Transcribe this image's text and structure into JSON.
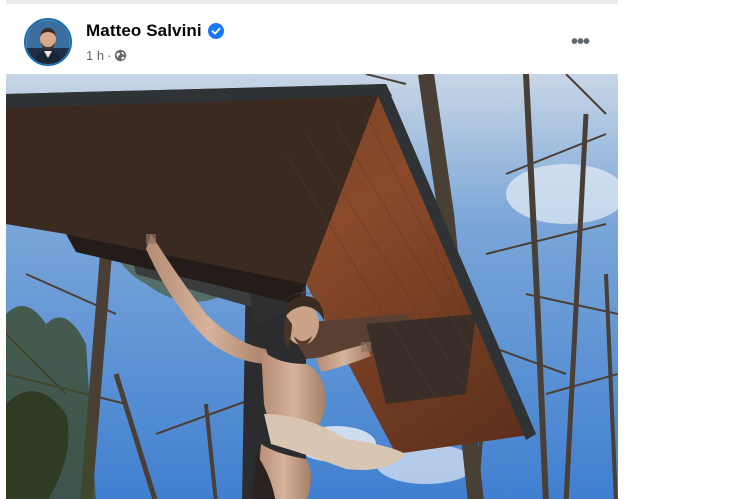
{
  "post": {
    "author_name": "Matteo Salvini",
    "verified": true,
    "timestamp": "1 h",
    "separator": "·",
    "privacy_icon": "globe-icon",
    "more_icon": "more-options-icon",
    "more_label": "•••"
  },
  "colors": {
    "link_blue": "#1877f2",
    "meta_gray": "#65676b",
    "name_black": "#050505"
  }
}
